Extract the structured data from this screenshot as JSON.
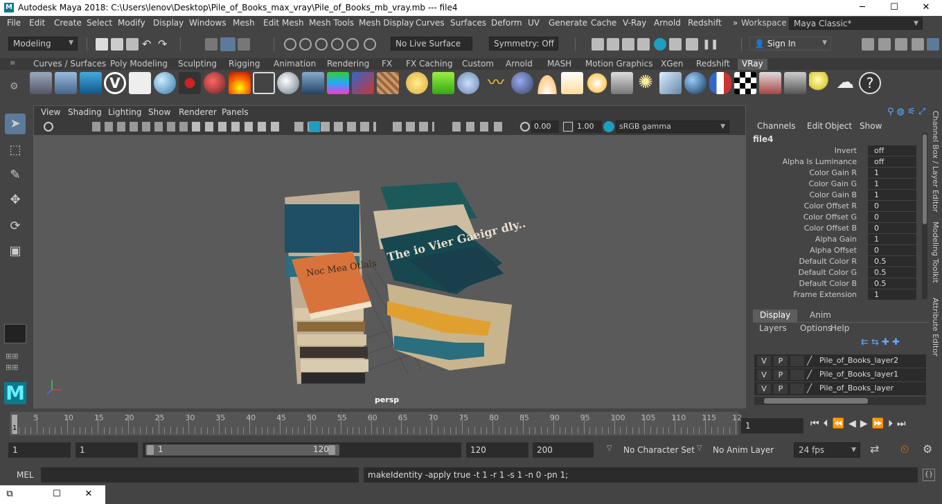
{
  "window": {
    "title": "Autodesk Maya 2018: C:\\Users\\lenov\\Desktop\\Pile_of_Books_max_vray\\Pile_of_Books_mb_vray.mb   ---   file4",
    "logo": "M",
    "minimize": "─",
    "maximize": "☐",
    "close": "✕"
  },
  "menubar": {
    "items": [
      "File",
      "Edit",
      "Create",
      "Select",
      "Modify",
      "Display",
      "Windows",
      "Mesh",
      "Edit Mesh",
      "Mesh Tools",
      "Mesh Display",
      "Curves",
      "Surfaces",
      "Deform",
      "UV",
      "Generate",
      "Cache",
      "V-Ray",
      "Arnold",
      "Redshift"
    ],
    "overflow": "»",
    "workspace_label": "Workspace :",
    "workspace_value": "Maya Classic*"
  },
  "statusline": {
    "mode": "Modeling",
    "live_surface": "No Live Surface",
    "symmetry": "Symmetry: Off",
    "sign_in": "Sign In"
  },
  "shelf": {
    "tabs": [
      "Curves / Surfaces",
      "Poly Modeling",
      "Sculpting",
      "Rigging",
      "Animation",
      "Rendering",
      "FX",
      "FX Caching",
      "Custom",
      "Arnold",
      "MASH",
      "Motion Graphics",
      "XGen",
      "Redshift",
      "VRay"
    ],
    "active_tab": "VRay",
    "icons": [
      "vray-asset-editor-icon",
      "vray-mesh-icon",
      "vray-proxy-icon",
      "vray-logo-icon",
      "vray-settings-icon",
      "vray-material-icon",
      "vray-camera-icon",
      "vray-shader-balls-icon",
      "vray-fire-icon",
      "vray-plane-icon",
      "vray-sphere-icon",
      "vray-light-cone-icon",
      "vray-blend-icon",
      "vray-lens-icon",
      "vray-texture-icon",
      "vray-dome-icon",
      "vray-fur-icon",
      "vray-scatter-icon",
      "vray-curves-icon",
      "vray-env-sphere-icon",
      "vray-dome-light-icon",
      "vray-spot-light-icon",
      "vray-sun-icon",
      "vray-ies-icon",
      "vray-sunlight-icon",
      "vray-rect-light-icon",
      "vray-ball-icon",
      "vray-shield-icon",
      "vray-checker-icon",
      "vray-render-icon",
      "vray-frame-buffer-icon",
      "vray-bulb-icon",
      "vray-cloud-icon",
      "help-icon"
    ]
  },
  "viewport": {
    "menu": [
      "View",
      "Shading",
      "Lighting",
      "Show",
      "Renderer",
      "Panels"
    ],
    "exposure": "0.00",
    "gamma": "1.00",
    "color_space": "sRGB gamma",
    "camera_label": "persp",
    "book_text_a": "The io Vier Gaeigr dly..",
    "book_text_b": "Noc Mea Otlals"
  },
  "channelbox": {
    "menu": [
      "Channels",
      "Edit",
      "Object",
      "Show"
    ],
    "node": "file4",
    "attributes": [
      {
        "label": "Invert",
        "value": "off"
      },
      {
        "label": "Alpha Is Luminance",
        "value": "off"
      },
      {
        "label": "Color Gain R",
        "value": "1"
      },
      {
        "label": "Color Gain G",
        "value": "1"
      },
      {
        "label": "Color Gain B",
        "value": "1"
      },
      {
        "label": "Color Offset R",
        "value": "0"
      },
      {
        "label": "Color Offset G",
        "value": "0"
      },
      {
        "label": "Color Offset B",
        "value": "0"
      },
      {
        "label": "Alpha Gain",
        "value": "1"
      },
      {
        "label": "Alpha Offset",
        "value": "0"
      },
      {
        "label": "Default Color R",
        "value": "0.5"
      },
      {
        "label": "Default Color G",
        "value": "0.5"
      },
      {
        "label": "Default Color B",
        "value": "0.5"
      },
      {
        "label": "Frame Extension",
        "value": "1"
      }
    ]
  },
  "sidetabs": [
    "Channel Box / Layer Editor",
    "Modeling Toolkit",
    "Attribute Editor"
  ],
  "layers": {
    "tabs": [
      "Display",
      "Anim"
    ],
    "menu": [
      "Layers",
      "Options",
      "Help"
    ],
    "rows": [
      {
        "v": "V",
        "p": "P",
        "name": "Pile_of_Books_layer2"
      },
      {
        "v": "V",
        "p": "P",
        "name": "Pile_of_Books_layer1"
      },
      {
        "v": "V",
        "p": "P",
        "name": "Pile_of_Books_layer"
      }
    ]
  },
  "timeslider": {
    "ticks": [
      "5",
      "10",
      "15",
      "20",
      "25",
      "30",
      "35",
      "40",
      "45",
      "50",
      "55",
      "60",
      "65",
      "70",
      "75",
      "80",
      "85",
      "90",
      "95",
      "100",
      "105",
      "110",
      "115",
      "12"
    ],
    "current_frame_marker": "1",
    "current_frame_field": "1"
  },
  "range": {
    "start": "1",
    "anim_start": "1",
    "slider_start": "1",
    "slider_end": "120",
    "end": "120",
    "anim_end": "200",
    "character_set": "No Character Set",
    "anim_layer": "No Anim Layer",
    "fps": "24 fps"
  },
  "commandline": {
    "language": "MEL",
    "output": "makeIdentity -apply true -t 1 -r 1 -s 1 -n 0 -pn 1;"
  }
}
